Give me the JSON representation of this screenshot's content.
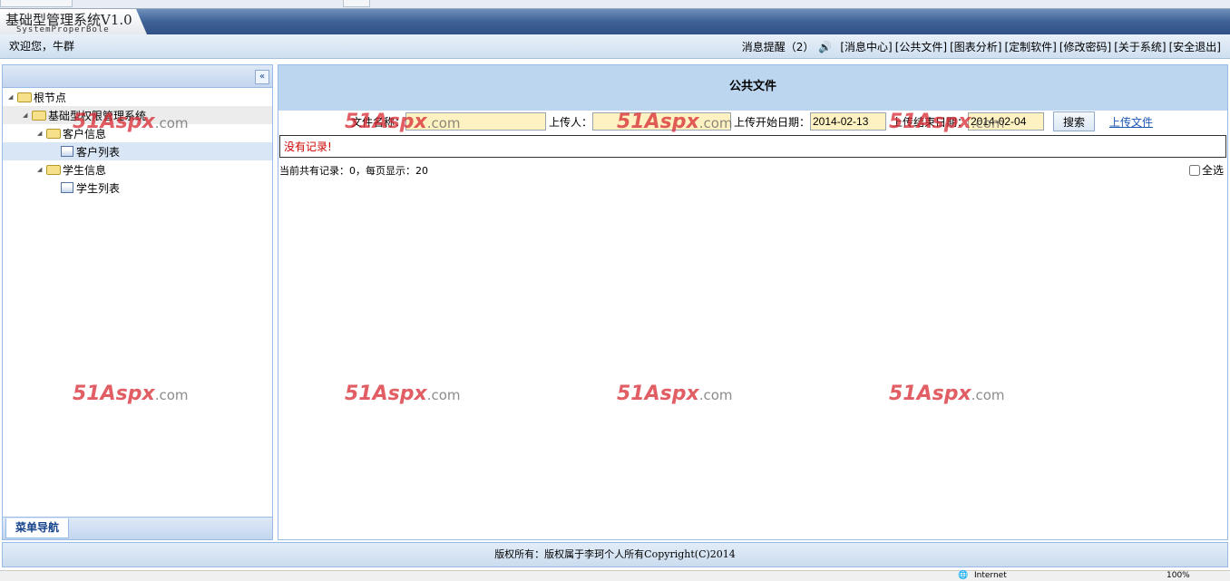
{
  "app": {
    "title": "基础型管理系统V1.0",
    "subtitle": "SystemProperBole",
    "welcome": "欢迎您，牛群"
  },
  "header": {
    "notice": "消息提醒（2）",
    "links": [
      "[消息中心]",
      "[公共文件]",
      "[图表分析]",
      "[定制软件]",
      "[修改密码]",
      "[关于系统]",
      "[安全退出]"
    ]
  },
  "sidebar": {
    "collapse_label": "«",
    "tab": "菜单导航",
    "tree": [
      {
        "label": "根节点",
        "type": "folder"
      },
      {
        "label": "基础型权限管理系统",
        "type": "folder"
      },
      {
        "label": "客户信息",
        "type": "folder"
      },
      {
        "label": "客户列表",
        "type": "leaf"
      },
      {
        "label": "学生信息",
        "type": "folder"
      },
      {
        "label": "学生列表",
        "type": "leaf"
      }
    ]
  },
  "main": {
    "title": "公共文件",
    "search": {
      "file_name_label": "文件名称：",
      "file_name_value": "",
      "uploader_label": "上传人：",
      "uploader_value": "",
      "start_label": "上传开始日期：",
      "start_value": "2014-02-13",
      "end_label": "上传结束日期：",
      "end_value": "2014-02-04",
      "search_button": "搜索",
      "upload_link": "上传文件"
    },
    "no_records": "没有记录!",
    "count_text": "当前共有记录：0，每页显示：20",
    "select_all": "全选"
  },
  "footer": {
    "copyright": "版权所有：版权属于李珂个人所有Copyright(C)2014"
  },
  "statusbar": {
    "zone": "Internet",
    "zoom": "100%"
  },
  "watermark": "51Aspx.com"
}
